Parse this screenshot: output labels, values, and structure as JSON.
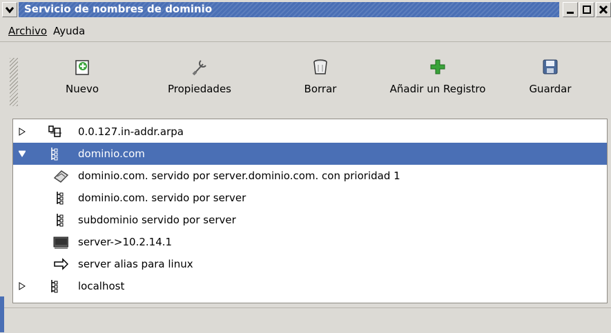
{
  "window": {
    "title": "Servicio de nombres de dominio"
  },
  "menu": [
    {
      "label": "Archivo"
    },
    {
      "label": "Ayuda"
    }
  ],
  "toolbar": [
    {
      "label": "Nuevo",
      "icon": "new-icon"
    },
    {
      "label": "Propiedades",
      "icon": "wrench-icon"
    },
    {
      "label": "Borrar",
      "icon": "trash-icon"
    },
    {
      "label": "Añadir un Registro",
      "icon": "plus-icon"
    },
    {
      "label": "Guardar",
      "icon": "floppy-icon"
    }
  ],
  "tree": {
    "rows": [
      {
        "text": "0.0.127.in-addr.arpa",
        "icon": "reverse-zone-icon",
        "expander": "collapsed"
      },
      {
        "text": "dominio.com",
        "icon": "domain-tree-icon",
        "expander": "expanded",
        "selected": true
      },
      {
        "text": "dominio.com. servido por  server.dominio.com. con prioridad 1",
        "icon": "mail-exchanger-icon"
      },
      {
        "text": "dominio.com. servido por server",
        "icon": "domain-tree-icon"
      },
      {
        "text": "subdominio servido por server",
        "icon": "domain-tree-icon"
      },
      {
        "text": "server->10.2.14.1",
        "icon": "host-computer-icon"
      },
      {
        "text": "server alias para linux",
        "icon": "alias-arrow-icon"
      },
      {
        "text": "localhost",
        "icon": "domain-tree-icon",
        "expander": "collapsed"
      }
    ]
  },
  "colors": {
    "selection": "#4a6fb5",
    "titlebar": "#4a6fb5",
    "window_bg": "#dcdad5"
  }
}
